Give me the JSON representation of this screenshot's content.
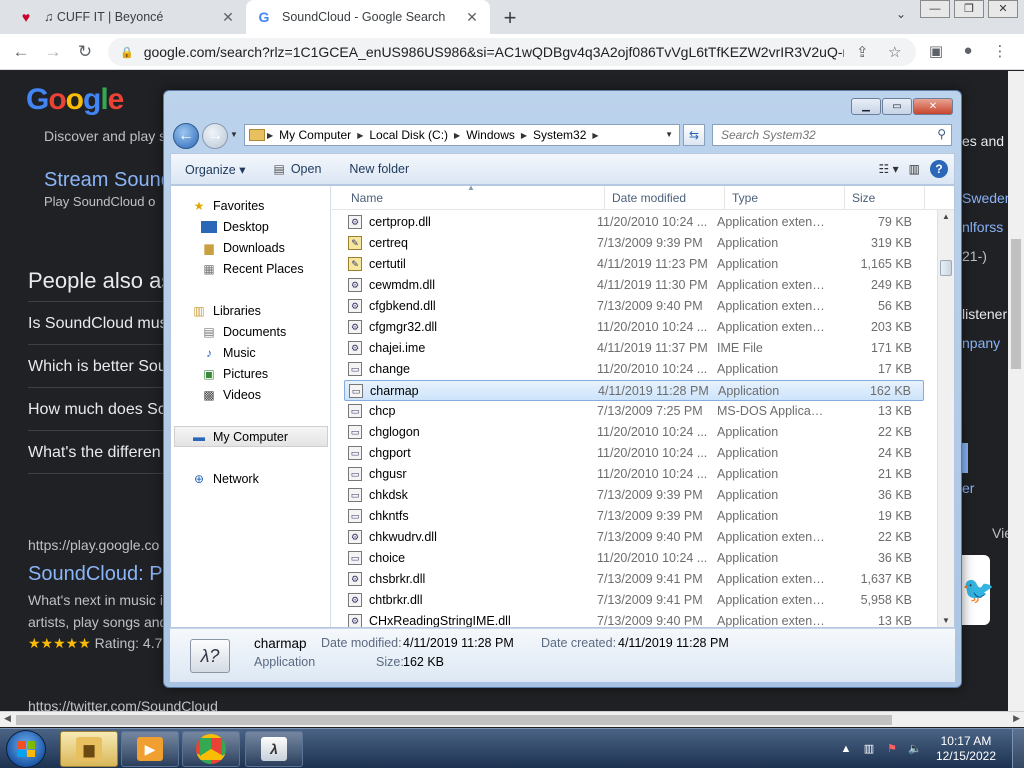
{
  "browser": {
    "tabs": [
      {
        "title": "♫ CUFF IT | Beyoncé",
        "icon": "iheart-icon"
      },
      {
        "title": "SoundCloud - Google Search",
        "icon": "google-icon"
      }
    ],
    "new_tab": "+",
    "url": "google.com/search?rlz=1C1GCEA_enUS986US986&si=AC1wQDBgv4q3A2ojf086TvVgL6tTfKEZW2vrIR3V2uQ-r4w...",
    "logo": [
      "G",
      "o",
      "o",
      "g",
      "l",
      "e"
    ]
  },
  "google_page": {
    "snippet_top": "Discover and play s",
    "stream_link": "Stream Sound",
    "stream_sub": "Play SoundCloud o",
    "paa_heading": "People also as",
    "questions": [
      "Is SoundCloud mus",
      "Which is better Sou",
      "How much does Sc",
      "What's the differen"
    ],
    "right_fragments": [
      "es and",
      "Sweden",
      "nlforss",
      "21-)",
      "listener",
      "npany",
      "er",
      "Vie"
    ],
    "result_url": "https://play.google.co",
    "result_title": "SoundCloud: Pl",
    "result_desc1": "What's next in music i",
    "result_desc2": "artists, play songs and",
    "rating_stars": "★★★★★",
    "rating_text": "Rating: 4.7",
    "twitter_url": "https://twitter.com/SoundCloud"
  },
  "explorer": {
    "address": [
      "My Computer",
      "Local Disk (C:)",
      "Windows",
      "System32"
    ],
    "search_placeholder": "Search System32",
    "commands": {
      "organize": "Organize ▾",
      "open": "Open",
      "new_folder": "New folder"
    },
    "nav": {
      "favorites": "Favorites",
      "fav_items": [
        "Desktop",
        "Downloads",
        "Recent Places"
      ],
      "libraries": "Libraries",
      "lib_items": [
        "Documents",
        "Music",
        "Pictures",
        "Videos"
      ],
      "computer": "My Computer",
      "network": "Network"
    },
    "columns": {
      "name": "Name",
      "date": "Date modified",
      "type": "Type",
      "size": "Size"
    },
    "files": [
      {
        "name": "certprop.dll",
        "date": "11/20/2010 10:24 ...",
        "type": "Application extens...",
        "size": "79 KB"
      },
      {
        "name": "certreq",
        "date": "7/13/2009 9:39 PM",
        "type": "Application",
        "size": "319 KB"
      },
      {
        "name": "certutil",
        "date": "4/11/2019 11:23 PM",
        "type": "Application",
        "size": "1,165 KB"
      },
      {
        "name": "cewmdm.dll",
        "date": "4/11/2019 11:30 PM",
        "type": "Application extens...",
        "size": "249 KB"
      },
      {
        "name": "cfgbkend.dll",
        "date": "7/13/2009 9:40 PM",
        "type": "Application extens...",
        "size": "56 KB"
      },
      {
        "name": "cfgmgr32.dll",
        "date": "11/20/2010 10:24 ...",
        "type": "Application extens...",
        "size": "203 KB"
      },
      {
        "name": "chajei.ime",
        "date": "4/11/2019 11:37 PM",
        "type": "IME File",
        "size": "171 KB"
      },
      {
        "name": "change",
        "date": "11/20/2010 10:24 ...",
        "type": "Application",
        "size": "17 KB"
      },
      {
        "name": "charmap",
        "date": "4/11/2019 11:28 PM",
        "type": "Application",
        "size": "162 KB"
      },
      {
        "name": "chcp",
        "date": "7/13/2009 7:25 PM",
        "type": "MS-DOS Applicati...",
        "size": "13 KB"
      },
      {
        "name": "chglogon",
        "date": "11/20/2010 10:24 ...",
        "type": "Application",
        "size": "22 KB"
      },
      {
        "name": "chgport",
        "date": "11/20/2010 10:24 ...",
        "type": "Application",
        "size": "24 KB"
      },
      {
        "name": "chgusr",
        "date": "11/20/2010 10:24 ...",
        "type": "Application",
        "size": "21 KB"
      },
      {
        "name": "chkdsk",
        "date": "7/13/2009 9:39 PM",
        "type": "Application",
        "size": "36 KB"
      },
      {
        "name": "chkntfs",
        "date": "7/13/2009 9:39 PM",
        "type": "Application",
        "size": "19 KB"
      },
      {
        "name": "chkwudrv.dll",
        "date": "7/13/2009 9:40 PM",
        "type": "Application extens...",
        "size": "22 KB"
      },
      {
        "name": "choice",
        "date": "11/20/2010 10:24 ...",
        "type": "Application",
        "size": "36 KB"
      },
      {
        "name": "chsbrkr.dll",
        "date": "7/13/2009 9:41 PM",
        "type": "Application extens...",
        "size": "1,637 KB"
      },
      {
        "name": "chtbrkr.dll",
        "date": "7/13/2009 9:41 PM",
        "type": "Application extens...",
        "size": "5,958 KB"
      },
      {
        "name": "CHxReadingStringIME.dll",
        "date": "7/13/2009 9:40 PM",
        "type": "Application extens...",
        "size": "13 KB"
      }
    ],
    "selected_index": 8,
    "details": {
      "name": "charmap",
      "type": "Application",
      "modified_label": "Date modified:",
      "modified": "4/11/2019 11:28 PM",
      "created_label": "Date created:",
      "created": "4/11/2019 11:28 PM",
      "size_label": "Size:",
      "size": "162 KB"
    }
  },
  "taskbar": {
    "time": "10:17 AM",
    "date": "12/15/2022"
  }
}
